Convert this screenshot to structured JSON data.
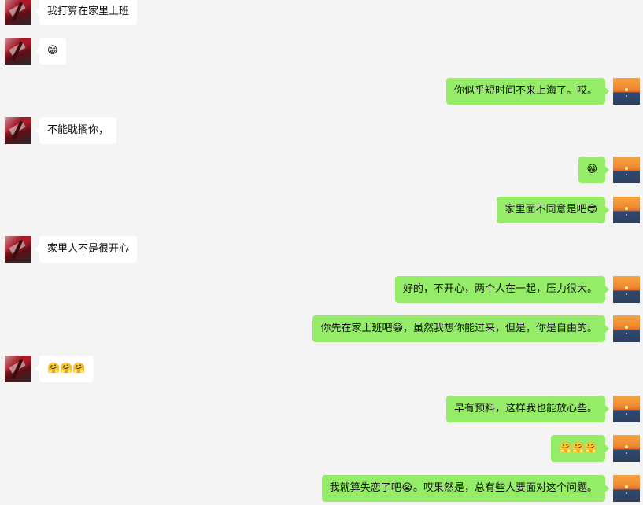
{
  "messages": [
    {
      "side": "left",
      "text": "我打算在家里上班"
    },
    {
      "side": "left",
      "text": "😁"
    },
    {
      "side": "right",
      "text": "你似乎短时间不来上海了。哎。"
    },
    {
      "side": "left",
      "text": "不能耽搁你，"
    },
    {
      "side": "right",
      "text": "😁"
    },
    {
      "side": "right",
      "text": "家里面不同意是吧😎"
    },
    {
      "side": "left",
      "text": "家里人不是很开心"
    },
    {
      "side": "right",
      "text": "好的，不开心，两个人在一起，压力很大。"
    },
    {
      "side": "right",
      "text": "你先在家上班吧😁，虽然我想你能过来，但是，你是自由的。"
    },
    {
      "side": "left",
      "text": "🤗🤗🤗"
    },
    {
      "side": "right",
      "text": "早有预料，这样我也能放心些。"
    },
    {
      "side": "right",
      "text": "🤗🤗🤗"
    },
    {
      "side": "right",
      "text": "我就算失恋了吧😭。哎果然是，总有些人要面对这个问题。"
    }
  ]
}
